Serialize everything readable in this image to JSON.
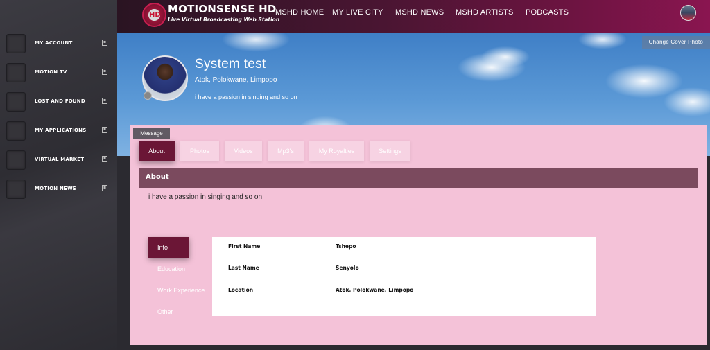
{
  "sidebar": {
    "items": [
      {
        "label": "MY ACCOUNT",
        "icon": "window-icon"
      },
      {
        "label": "MOTION TV",
        "icon": "window-icon"
      },
      {
        "label": "LOST AND FOUND",
        "icon": "window-icon"
      },
      {
        "label": "MY APPLICATIONS",
        "icon": "window-icon"
      },
      {
        "label": "VIRTUAL MARKET",
        "icon": "window-icon"
      },
      {
        "label": "MOTION NEWS",
        "icon": "window-icon"
      }
    ]
  },
  "header": {
    "logo_badge": "HD",
    "logo_title": "MOTIONSENSE HD",
    "logo_subtitle": "Live Virtual Broadcasting Web Station",
    "nav": [
      "MSHD HOME",
      "MY LIVE CITY",
      "MSHD NEWS",
      "MSHD ARTISTS",
      "PODCASTS"
    ]
  },
  "cover": {
    "change_cover_label": "Change Cover Photo"
  },
  "profile": {
    "name": "System test",
    "location": "Atok, Polokwane, Limpopo",
    "bio": "i have a passion in singing and so on",
    "message_label": "Message"
  },
  "tabs": {
    "items": [
      "About",
      "Photos",
      "Videos",
      "Mp3's",
      "My Royalties",
      "Settings"
    ],
    "active": "About"
  },
  "about": {
    "heading": "About",
    "text": "i have a passion in singing and so on"
  },
  "side_tabs": {
    "items": [
      "Info",
      "Education",
      "Work Experience",
      "Other"
    ],
    "active": "Info"
  },
  "info": {
    "rows": [
      {
        "label": "First Name",
        "value": "Tshepo"
      },
      {
        "label": "Last Name",
        "value": "Senyolo"
      },
      {
        "label": "Location",
        "value": "Atok, Polokwane, Limpopo"
      }
    ]
  },
  "colors": {
    "accent": "#6b1636",
    "panel": "#f4c2d8",
    "header_bar": "#7b4a5e",
    "sidebar": "#2e2d33"
  }
}
